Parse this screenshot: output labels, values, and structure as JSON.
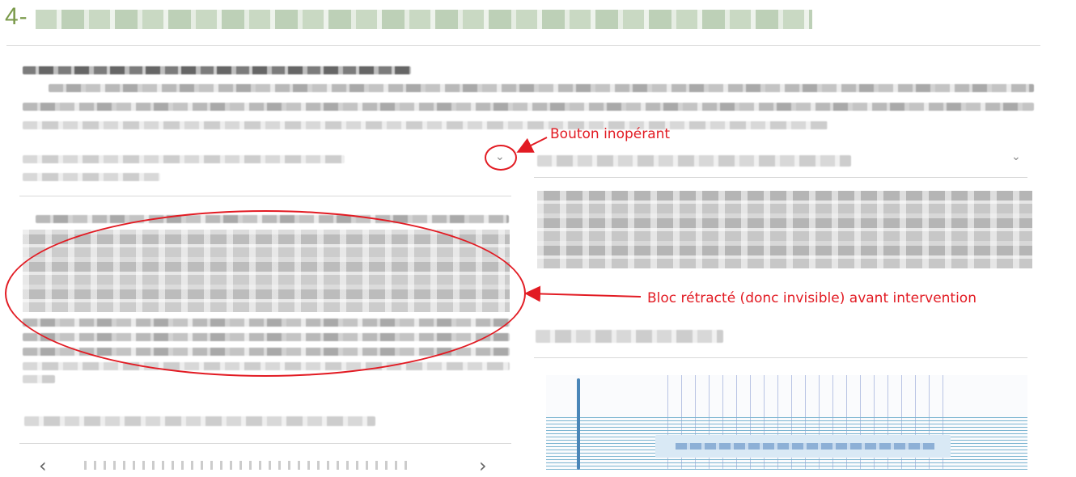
{
  "heading": {
    "number": "4-"
  },
  "annotations": {
    "button_note": "Bouton inopérant",
    "block_note": "Bloc rétracté (donc invisible) avant intervention"
  },
  "accordion": {
    "left_chevron": "⌄",
    "right_chevron": "⌄"
  },
  "carousel": {
    "prev": "‹",
    "next": "›"
  },
  "colors": {
    "annotation": "#e21b23",
    "heading_number": "#7a9a4a"
  }
}
